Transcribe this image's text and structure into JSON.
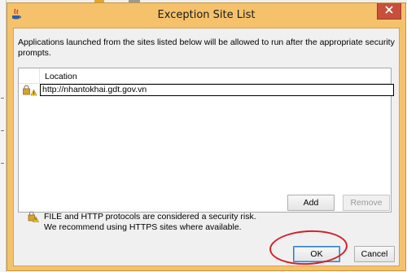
{
  "dialog": {
    "title": "Exception Site List",
    "description": "Applications launched from the sites listed below will be allowed to run after the appropriate security prompts.",
    "table": {
      "column_header": "Location",
      "rows": [
        {
          "location": "http://nhantokhai.gdt.gov.vn"
        }
      ]
    },
    "buttons": {
      "add": "Add",
      "remove": "Remove",
      "ok": "OK",
      "cancel": "Cancel"
    },
    "warning_line1": "FILE and HTTP protocols are considered a security risk.",
    "warning_line2": "We recommend using HTTPS sites where available."
  },
  "icons": {
    "app": "java-icon",
    "close": "close-icon",
    "row": "lock-warning-icon",
    "warning": "lock-warning-icon"
  },
  "colors": {
    "title_bar": "#f5c26b",
    "close_button": "#c74f3c",
    "highlight_circle": "#d31f2a"
  }
}
